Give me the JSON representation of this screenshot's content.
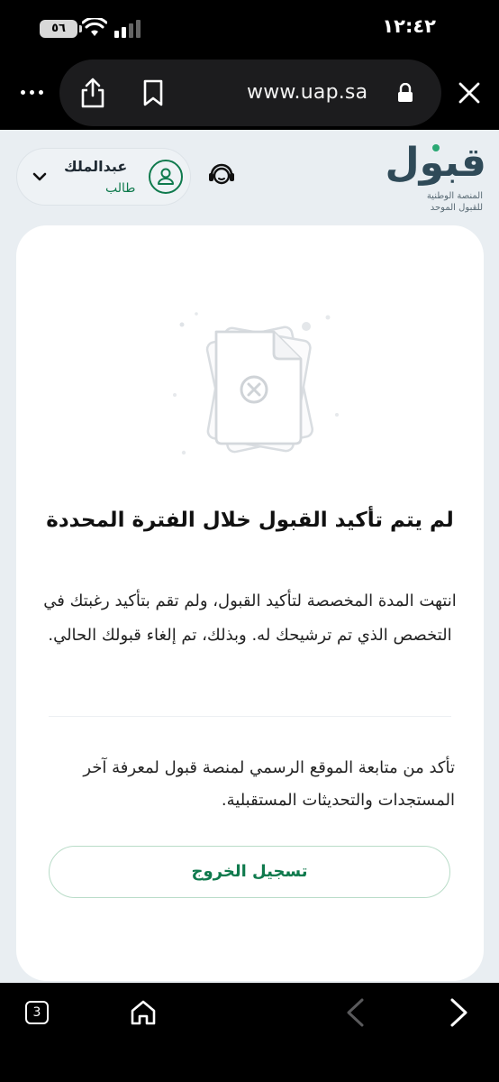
{
  "status_bar": {
    "time": "١٢:٤٢",
    "battery": "٥٦"
  },
  "browser": {
    "url": "www.uap.sa",
    "tab_count": "3"
  },
  "header": {
    "user_name": "عبدالملك",
    "user_role": "طالب",
    "logo_word": "قبول",
    "logo_line1": "المنصة الوطنية",
    "logo_line2": "للقبول الموحد"
  },
  "card": {
    "title": "لم يتم تأكيد القبول خلال الفترة المحددة",
    "message": "انتهت المدة المخصصة لتأكيد القبول، ولم تقم بتأكيد رغبتك في التخصص الذي تم ترشيحك له. وبذلك، تم إلغاء قبولك الحالي.",
    "note": "تأكد من متابعة الموقع الرسمي لمنصة قبول لمعرفة آخر المستجدات والتحديثات المستقبلية.",
    "logout_label": "تسجيل الخروج"
  },
  "colors": {
    "accent": "#0f7a4d",
    "page_bg": "#e9eef2",
    "logo_text": "#2f4a58"
  }
}
